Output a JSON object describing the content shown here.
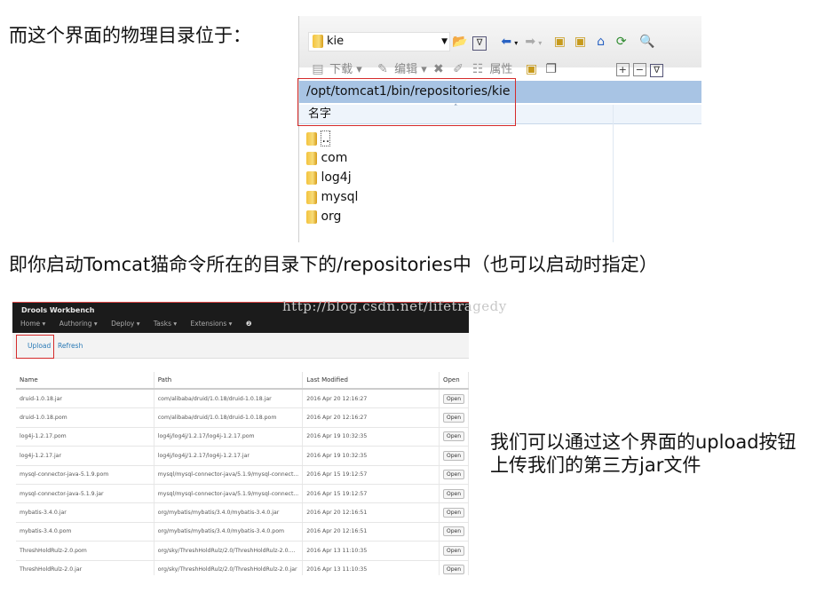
{
  "captions": {
    "line1": "而这个界面的物理目录位于：",
    "line2": "即你启动Tomcat猫命令所在的目录下的/repositories中（也可以启动时指定）",
    "line3a": "我们可以通过这个界面的upload按钮",
    "line3b": "上传我们的第三方jar文件"
  },
  "file_manager": {
    "address_value": "kie",
    "toolbar2": {
      "download": "下载",
      "edit": "编辑",
      "properties": "属性"
    },
    "path": "/opt/tomcat1/bin/repositories/kie",
    "column_name": "名字",
    "items": [
      "..",
      "com",
      "log4j",
      "mysql",
      "org"
    ]
  },
  "workbench": {
    "brand": "Drools Workbench",
    "nav": [
      "Home ▾",
      "Authoring ▾",
      "Deploy ▾",
      "Tasks ▾",
      "Extensions ▾"
    ],
    "help": "❷",
    "upload": "Upload",
    "refresh": "Refresh",
    "columns": [
      "Name",
      "Path",
      "Last Modified",
      "Open"
    ],
    "open_label": "Open",
    "rows": [
      [
        "druid-1.0.18.jar",
        "com/alibaba/druid/1.0.18/druid-1.0.18.jar",
        "2016 Apr 20 12:16:27"
      ],
      [
        "druid-1.0.18.pom",
        "com/alibaba/druid/1.0.18/druid-1.0.18.pom",
        "2016 Apr 20 12:16:27"
      ],
      [
        "log4j-1.2.17.pom",
        "log4j/log4j/1.2.17/log4j-1.2.17.pom",
        "2016 Apr 19 10:32:35"
      ],
      [
        "log4j-1.2.17.jar",
        "log4j/log4j/1.2.17/log4j-1.2.17.jar",
        "2016 Apr 19 10:32:35"
      ],
      [
        "mysql-connector-java-5.1.9.pom",
        "mysql/mysql-connector-java/5.1.9/mysql-connect...",
        "2016 Apr 15 19:12:57"
      ],
      [
        "mysql-connector-java-5.1.9.jar",
        "mysql/mysql-connector-java/5.1.9/mysql-connect...",
        "2016 Apr 15 19:12:57"
      ],
      [
        "mybatis-3.4.0.jar",
        "org/mybatis/mybatis/3.4.0/mybatis-3.4.0.jar",
        "2016 Apr 20 12:16:51"
      ],
      [
        "mybatis-3.4.0.pom",
        "org/mybatis/mybatis/3.4.0/mybatis-3.4.0.pom",
        "2016 Apr 20 12:16:51"
      ],
      [
        "ThreshHoldRulz-2.0.pom",
        "org/sky/ThreshHoldRulz/2.0/ThreshHoldRulz-2.0....",
        "2016 Apr 13 11:10:35"
      ],
      [
        "ThreshHoldRulz-2.0.jar",
        "org/sky/ThreshHoldRulz/2.0/ThreshHoldRulz-2.0.jar",
        "2016 Apr 13 11:10:35"
      ]
    ]
  },
  "watermark": "http://blog.csdn.net/lifetragedy"
}
